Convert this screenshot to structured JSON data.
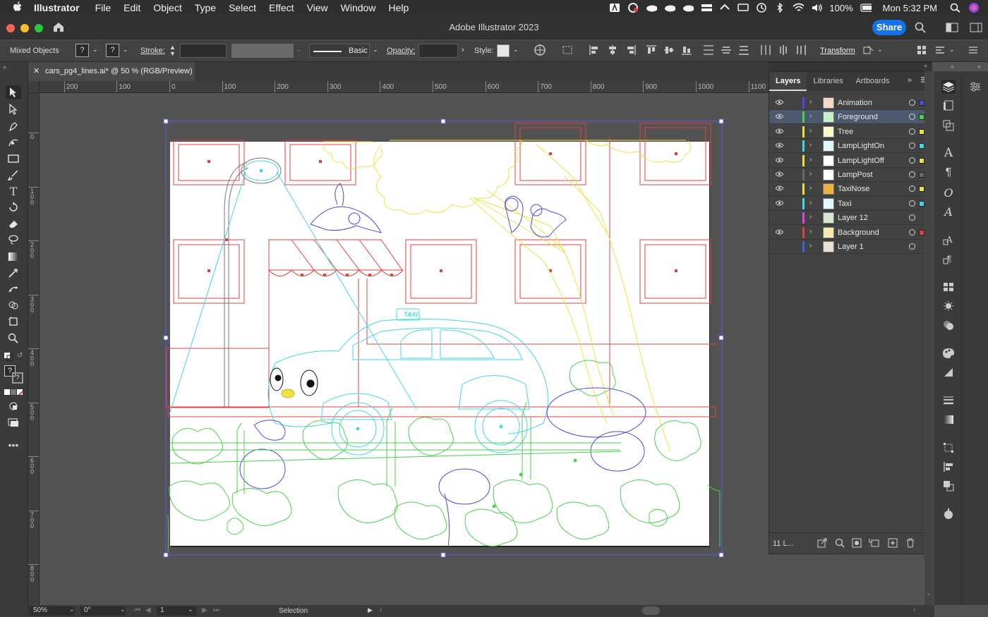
{
  "menubar": {
    "app": "Illustrator",
    "items": [
      "File",
      "Edit",
      "Object",
      "Type",
      "Select",
      "Effect",
      "View",
      "Window",
      "Help"
    ],
    "battery": "100%",
    "clock": "Mon 5:32 PM"
  },
  "window": {
    "title": "Adobe Illustrator 2023",
    "share_label": "Share"
  },
  "control_bar": {
    "selection_type": "Mixed Objects",
    "fill_value": "?",
    "stroke_swatch_value": "?",
    "stroke_label": "Stroke:",
    "stroke_value": "",
    "brush_label": "Basic",
    "opacity_label": "Opacity:",
    "opacity_value": "",
    "style_label": "Style:",
    "transform_label": "Transform"
  },
  "document_tab": {
    "name": "cars_pg4_lines.ai* @ 50 % (RGB/Preview)"
  },
  "rulers": {
    "horizontal_ticks": [
      "200",
      "100",
      "0",
      "100",
      "200",
      "300",
      "400",
      "500",
      "600",
      "700",
      "800",
      "900",
      "1000",
      "1100"
    ],
    "vertical_ticks": [
      "0",
      "100",
      "200",
      "300",
      "400",
      "500",
      "600",
      "700",
      "800"
    ]
  },
  "layers_panel": {
    "tabs": [
      "Layers",
      "Libraries",
      "Artboards"
    ],
    "active_tab": "Layers",
    "layers": [
      {
        "name": "Animation",
        "color": "#4a4adf",
        "visible": true,
        "selected": false
      },
      {
        "name": "Foreground",
        "color": "#4ad14a",
        "visible": true,
        "selected": true
      },
      {
        "name": "Tree",
        "color": "#f0e040",
        "visible": true,
        "selected": false
      },
      {
        "name": "LampLightOn",
        "color": "#40d8e8",
        "visible": true,
        "selected": false
      },
      {
        "name": "LampLightOff",
        "color": "#f0e040",
        "visible": true,
        "selected": false
      },
      {
        "name": "LampPost",
        "color": "#6a6a6a",
        "visible": true,
        "selected": false
      },
      {
        "name": "TaxiNose",
        "color": "#f0e040",
        "visible": true,
        "selected": false
      },
      {
        "name": "Taxi",
        "color": "#40d8e8",
        "visible": true,
        "selected": false
      },
      {
        "name": "Layer 12",
        "color": "#e040e0",
        "visible": false,
        "selected": false
      },
      {
        "name": "Background",
        "color": "#e04040",
        "visible": true,
        "selected": false
      },
      {
        "name": "Layer 1",
        "color": "#4060e0",
        "visible": false,
        "selected": false
      }
    ],
    "footer_count": "11 L..."
  },
  "status_bar": {
    "zoom": "50%",
    "rotation": "0°",
    "artboard_number": "1",
    "tool_status": "Selection"
  },
  "artwork": {
    "taxi_sign": "TAXI"
  },
  "colors": {
    "accent": "#1473e6",
    "background_outline": "#e04040",
    "foreground_outline": "#4ad14a",
    "taxi_outline": "#40d8e8",
    "tree_outline": "#f0e040",
    "animation_outline": "#4a4adf"
  }
}
